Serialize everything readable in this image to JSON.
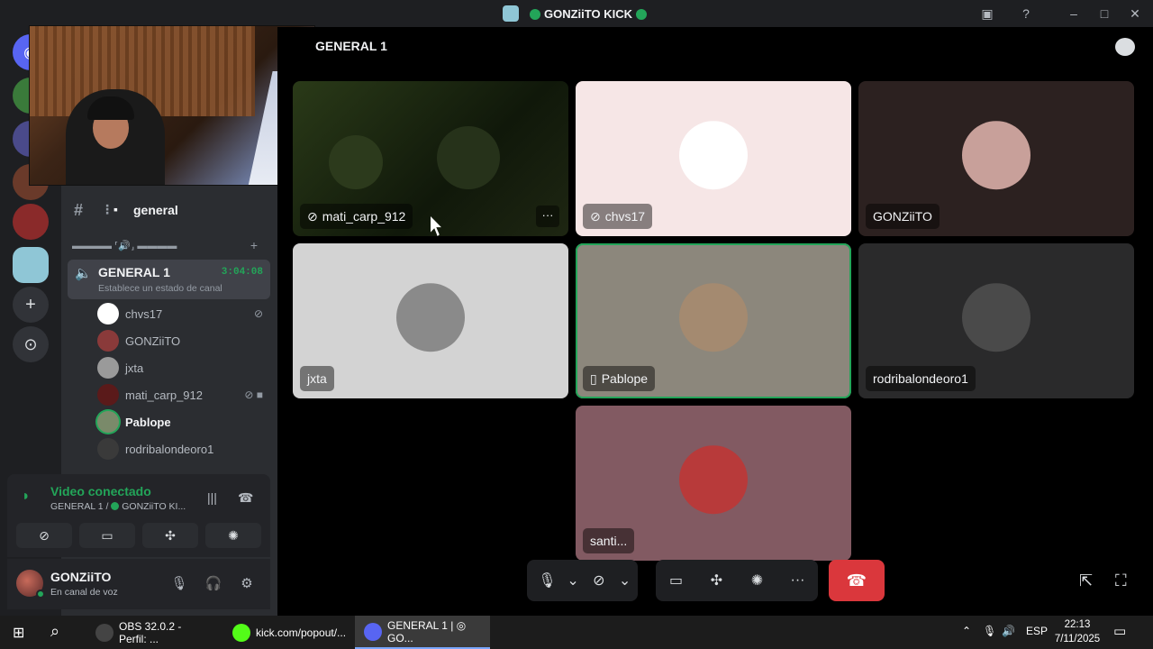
{
  "window": {
    "title": "GONZiiTO KICK",
    "controls": [
      "minimize",
      "maximize",
      "close"
    ]
  },
  "guilds": [
    {
      "icon": "discord-home-icon"
    },
    {
      "icon": "server-green-icon"
    },
    {
      "icon": "server-avatar-icon"
    },
    {
      "icon": "server-sports-icon"
    },
    {
      "icon": "server-active-icon"
    },
    {
      "icon": "add-server-icon"
    },
    {
      "icon": "discover-icon"
    }
  ],
  "sidebar": {
    "text_channel": "general",
    "voice_category": "▬▬▬▬ ⸢🔊⸥ ▬▬▬▬",
    "voice_channel": {
      "name": "GENERAL 1",
      "timer": "3:04:08",
      "status": "Establece un estado de canal"
    },
    "members": [
      {
        "name": "chvs17",
        "muted": true,
        "video": false,
        "speaking": false,
        "color": "#ffffff"
      },
      {
        "name": "GONZiiTO",
        "muted": false,
        "video": false,
        "speaking": false,
        "color": "#8a3a3a"
      },
      {
        "name": "jxta",
        "muted": false,
        "video": false,
        "speaking": false,
        "color": "#9a9a9a"
      },
      {
        "name": "mati_carp_912",
        "muted": true,
        "video": true,
        "speaking": false,
        "color": "#5a1a1a"
      },
      {
        "name": "Pablope",
        "muted": false,
        "video": false,
        "speaking": true,
        "color": "#7a8a6a"
      },
      {
        "name": "rodribalondeoro1",
        "muted": false,
        "video": false,
        "speaking": false,
        "color": "#3a3a3a"
      }
    ]
  },
  "voice_panel": {
    "status": "Video conectado",
    "location_channel": "GENERAL 1 /",
    "location_server": "GONZiiTO KI..."
  },
  "user": {
    "name": "GONZiiTO",
    "status": "En canal de voz"
  },
  "stage": {
    "title": "GENERAL 1",
    "tiles": [
      {
        "name": "mati_carp_912",
        "muted": true,
        "bg": "#1b2410",
        "avatar": "",
        "active": false,
        "video": true
      },
      {
        "name": "chvs17",
        "muted": true,
        "bg": "#f6e6e6",
        "avatar": "#ffffff",
        "active": false,
        "video": false
      },
      {
        "name": "GONZiiTO",
        "muted": false,
        "bg": "#2c2120",
        "avatar": "#c8a09a",
        "active": false,
        "video": false
      },
      {
        "name": "jxta",
        "muted": false,
        "bg": "#d3d3d3",
        "avatar": "#8a8a8a",
        "active": false,
        "video": false
      },
      {
        "name": "Pablope",
        "muted": false,
        "bg": "#8c877c",
        "avatar": "#a48a70",
        "active": true,
        "video": false,
        "mobile": true
      },
      {
        "name": "rodribalondeoro1",
        "muted": false,
        "bg": "#2a2a2b",
        "avatar": "#4a4a4a",
        "active": false,
        "video": false
      },
      {
        "name": "santi...",
        "muted": false,
        "bg": "#825a62",
        "avatar": "#b83a3a",
        "active": false,
        "video": false
      }
    ]
  },
  "taskbar": {
    "tasks": [
      {
        "label": "OBS 32.0.2 - Perfil: ...",
        "color": "#444"
      },
      {
        "label": "kick.com/popout/...",
        "color": "#53fc18"
      },
      {
        "label": "GENERAL 1 | ◎ GO...",
        "color": "#5865f2"
      }
    ],
    "lang": "ESP",
    "time": "22:13",
    "date": "7/11/2025"
  }
}
